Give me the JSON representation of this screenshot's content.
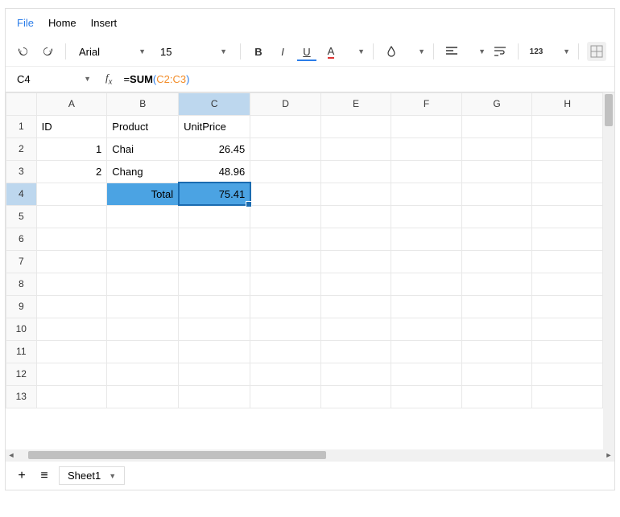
{
  "menu": {
    "file": "File",
    "home": "Home",
    "insert": "Insert"
  },
  "toolbar": {
    "font": "Arial",
    "size": "15",
    "numfmt": "123"
  },
  "formula": {
    "cell_ref": "C4",
    "eq": "=",
    "func": "SUM",
    "open": "(",
    "range": "C2:C3",
    "close": ")"
  },
  "columns": [
    "A",
    "B",
    "C",
    "D",
    "E",
    "F",
    "G",
    "H"
  ],
  "rows": [
    "1",
    "2",
    "3",
    "4",
    "5",
    "6",
    "7",
    "8",
    "9",
    "10",
    "11",
    "12",
    "13"
  ],
  "cells": {
    "A1": "ID",
    "B1": "Product",
    "C1": "UnitPrice",
    "A2": "1",
    "B2": "Chai",
    "C2": "26.45",
    "A3": "2",
    "B3": "Chang",
    "C3": "48.96",
    "B4": "Total",
    "C4": "75.41"
  },
  "sheet": {
    "name": "Sheet1"
  },
  "chart_data": {
    "type": "table",
    "columns": [
      "ID",
      "Product",
      "UnitPrice"
    ],
    "rows": [
      {
        "ID": 1,
        "Product": "Chai",
        "UnitPrice": 26.45
      },
      {
        "ID": 2,
        "Product": "Chang",
        "UnitPrice": 48.96
      }
    ],
    "total": {
      "label": "Total",
      "UnitPrice": 75.41,
      "formula": "=SUM(C2:C3)"
    }
  }
}
